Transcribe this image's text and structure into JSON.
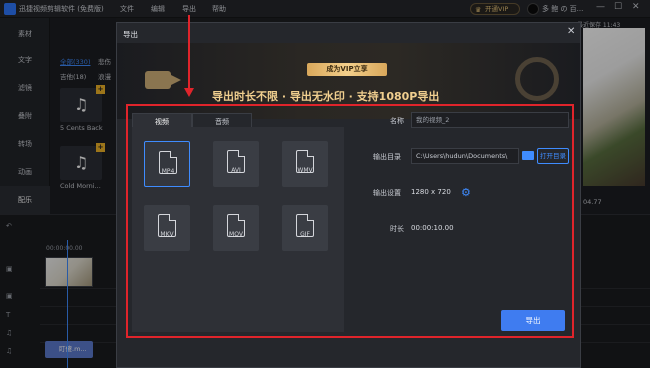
{
  "app": {
    "title": "迅捷视频剪辑软件 (免费版)",
    "menus": [
      "文件",
      "编辑",
      "导出",
      "帮助"
    ],
    "vip_label": "开通VIP",
    "user_name": "多 鲍 の 百..."
  },
  "sidebar": {
    "items": [
      {
        "label": "素材"
      },
      {
        "label": "文字"
      },
      {
        "label": "滤镜"
      },
      {
        "label": "叠附"
      },
      {
        "label": "转场"
      },
      {
        "label": "动画"
      },
      {
        "label": "配乐"
      }
    ]
  },
  "media": {
    "tabs": [
      "全部(330)",
      "悲伤",
      "吉他(18)",
      "浪漫"
    ],
    "items": [
      {
        "label": "5 Cents Back"
      },
      {
        "label": "Cold Morni..."
      }
    ]
  },
  "preview": {
    "time_label": "最近保存 11:43",
    "timestamp": "04.77"
  },
  "timeline": {
    "ruler_start": "00:00:00.00",
    "audio_clip": "盯傻.m..."
  },
  "dialog": {
    "title": "导出",
    "banner_badge": "成为VIP立享",
    "banner_text": "导出时长不限 · 导出无水印 · 支持1080P导出",
    "tabs": [
      "视频",
      "音频"
    ],
    "formats": [
      "MP4",
      "AVI",
      "WMV",
      "MKV",
      "MOV",
      "GIF"
    ],
    "name_label": "名称",
    "name_value": "我的视频_2",
    "dir_label": "输出目录",
    "dir_value": "C:\\Users\\hudun\\Documents\\",
    "open_dir": "打开目录",
    "setting_label": "输出设置",
    "setting_value": "1280 x 720",
    "duration_label": "时长",
    "duration_value": "00:00:10.00",
    "export_label": "导出"
  }
}
